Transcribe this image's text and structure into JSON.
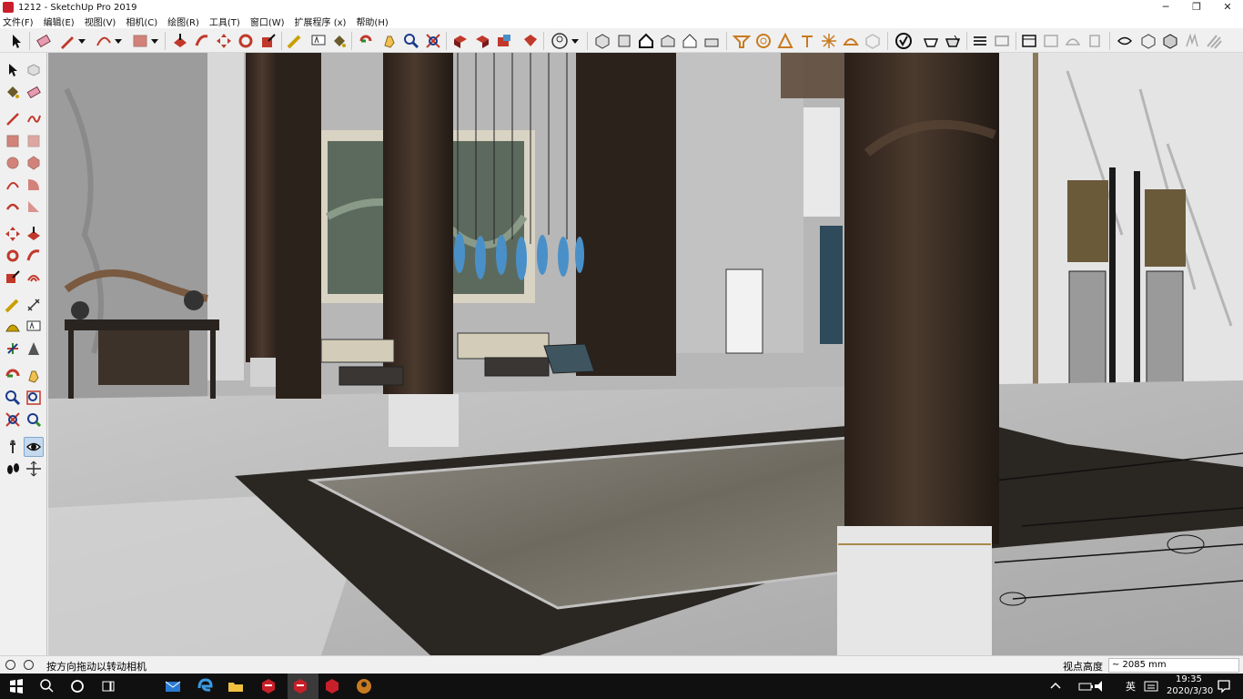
{
  "window": {
    "title": "1212 - SketchUp Pro 2019"
  },
  "window_controls": [
    "─",
    "❐",
    "✕"
  ],
  "menu": [
    "文件(F)",
    "编辑(E)",
    "视图(V)",
    "相机(C)",
    "绘图(R)",
    "工具(T)",
    "窗口(W)",
    "扩展程序 (x)",
    "帮助(H)"
  ],
  "status": {
    "hint": "按方向拖动以转动相机",
    "vcb_label": "视点高度",
    "vcb_value": "~ 2085 mm"
  },
  "taskbar": {
    "time": "19:35",
    "date": "2020/3/30",
    "ime": "英"
  },
  "colors": {
    "sketchup_red": "#c8202a",
    "wood_dark": "#3d2f26",
    "marble_light": "#d9d9d9",
    "chandelier_blue": "#4a90c8",
    "taskbar_bg": "#101010"
  },
  "icons": {
    "toolbar": [
      "select-icon",
      "eraser-icon",
      "pencil-icon",
      "arc-icon",
      "rectangle-icon",
      "push-pull-icon",
      "move-icon",
      "rotate-icon",
      "scale-icon",
      "tape-measure-icon",
      "text-icon",
      "paint-bucket-icon",
      "orbit-icon",
      "pan-icon",
      "zoom-icon",
      "zoom-extents-icon",
      "3d-warehouse-icon",
      "extension-warehouse-icon",
      "layout-icon",
      "ruby-icon",
      "account-icon",
      "views-icon",
      "styles-icon",
      "sandbox-icon",
      "section-icon",
      "shadows-icon",
      "solid-tools-icon"
    ],
    "sidebar": [
      "select-icon",
      "component-icon",
      "paint-bucket-icon",
      "eraser-icon",
      "line-icon",
      "freehand-icon",
      "rectangle-icon",
      "rotated-rect-icon",
      "circle-icon",
      "polygon-icon",
      "arc-icon",
      "pie-icon",
      "move-icon",
      "push-pull-icon",
      "rotate-icon",
      "follow-me-icon",
      "scale-icon",
      "offset-icon",
      "tape-measure-icon",
      "dimension-icon",
      "protractor-icon",
      "text-icon",
      "axes-icon",
      "3d-text-icon",
      "orbit-icon",
      "pan-icon",
      "zoom-icon",
      "zoom-window-icon",
      "zoom-extents-icon",
      "previous-view-icon",
      "position-camera-icon",
      "look-around-icon",
      "walk-icon",
      "section-plane-icon"
    ]
  }
}
